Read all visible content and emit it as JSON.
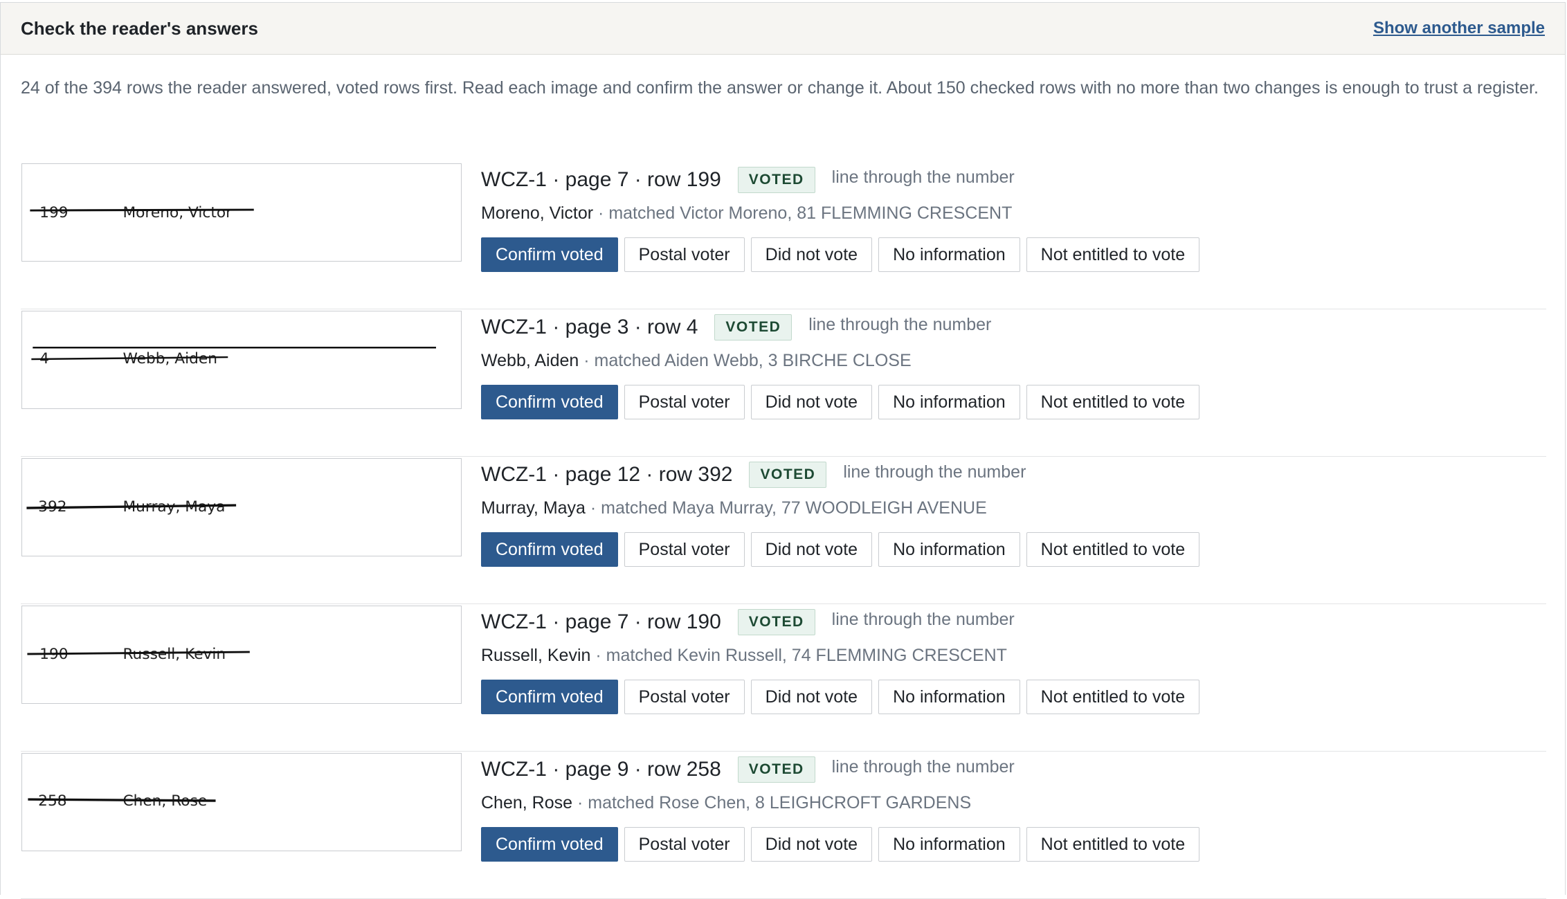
{
  "header": {
    "title": "Check the reader's answers",
    "link": "Show another sample"
  },
  "intro": "24 of the 394 rows the reader answered, voted rows first. Read each image and confirm the answer or change it. About 150 checked rows with no more than two changes is enough to trust a register.",
  "buttons": {
    "confirm": "Confirm voted",
    "postal": "Postal voter",
    "did_not": "Did not vote",
    "no_info": "No information",
    "not_entitled": "Not entitled to vote"
  },
  "rows": [
    {
      "ref": "WCZ-1 · page 7 · row 199",
      "badge": "VOTED",
      "reason": "line through the number",
      "name": "Moreno, Victor",
      "match": " · matched Victor Moreno, 81 FLEMMING CRESCENT",
      "img_num": "199",
      "img_name": "Moreno, Victor"
    },
    {
      "ref": "WCZ-1 · page 3 · row 4",
      "badge": "VOTED",
      "reason": "line through the number",
      "name": "Webb, Aiden",
      "match": " · matched Aiden Webb, 3 BIRCHE CLOSE",
      "img_num": "4",
      "img_name": "Webb, Aiden"
    },
    {
      "ref": "WCZ-1 · page 12 · row 392",
      "badge": "VOTED",
      "reason": "line through the number",
      "name": "Murray, Maya",
      "match": " · matched Maya Murray, 77 WOODLEIGH AVENUE",
      "img_num": "392",
      "img_name": "Murray, Maya"
    },
    {
      "ref": "WCZ-1 · page 7 · row 190",
      "badge": "VOTED",
      "reason": "line through the number",
      "name": "Russell, Kevin",
      "match": " · matched Kevin Russell, 74 FLEMMING CRESCENT",
      "img_num": "190",
      "img_name": "Russell, Kevin"
    },
    {
      "ref": "WCZ-1 · page 9 · row 258",
      "badge": "VOTED",
      "reason": "line through the number",
      "name": "Chen, Rose",
      "match": " · matched Rose Chen, 8 LEIGHCROFT GARDENS",
      "img_num": "258",
      "img_name": "Chen, Rose"
    }
  ]
}
